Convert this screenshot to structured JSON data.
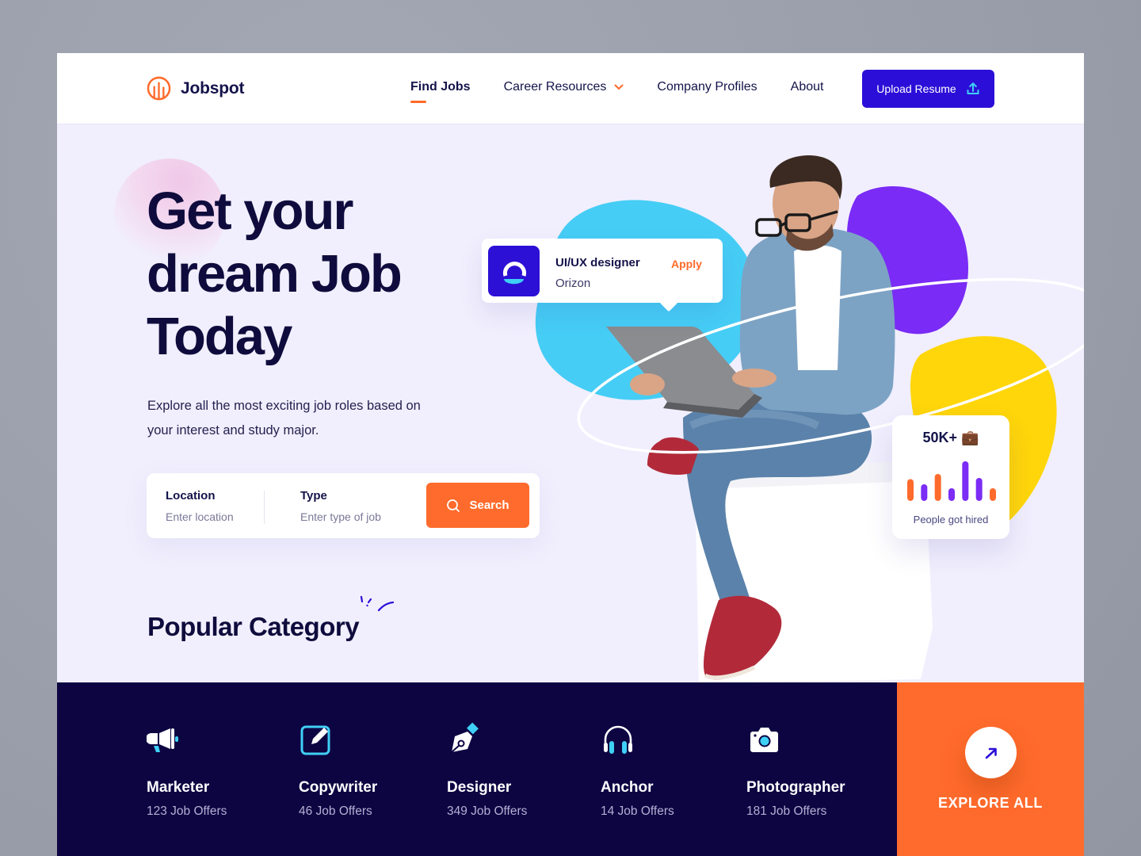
{
  "brand": {
    "name": "Jobspot",
    "accent": "#ff6b2c",
    "primary": "#2b0fd8",
    "dark": "#0d0442"
  },
  "nav": {
    "items": [
      {
        "label": "Find Jobs",
        "active": true
      },
      {
        "label": "Career Resources",
        "has_dropdown": true
      },
      {
        "label": "Company Profiles"
      },
      {
        "label": "About"
      }
    ],
    "cta_label": "Upload Resume",
    "cta_icon": "upload-icon"
  },
  "hero": {
    "title_lines": [
      "Get your",
      "dream Job",
      "Today"
    ],
    "subtitle": "Explore all the most exciting job roles based on your interest and study major."
  },
  "search": {
    "location": {
      "label": "Location",
      "placeholder": "Enter location",
      "value": ""
    },
    "type": {
      "label": "Type",
      "placeholder": "Enter type of job",
      "value": ""
    },
    "button_label": "Search",
    "button_icon": "search-icon"
  },
  "job_card": {
    "title": "UI/UX designer",
    "company": "Orizon",
    "action": "Apply",
    "logo_color": "#2c10d6"
  },
  "stat_card": {
    "value": "50K+",
    "emoji": "💼",
    "label": "People got hired",
    "bars": [
      {
        "value": 0.55,
        "color": "#ff6b2c"
      },
      {
        "value": 0.42,
        "color": "#7b2cf5"
      },
      {
        "value": 0.68,
        "color": "#ff6b2c"
      },
      {
        "value": 0.32,
        "color": "#7b2cf5"
      },
      {
        "value": 1.0,
        "color": "#7b2cf5"
      },
      {
        "value": 0.58,
        "color": "#7b2cf5"
      },
      {
        "value": 0.32,
        "color": "#ff6b2c"
      }
    ]
  },
  "popular": {
    "title": "Popular Category",
    "categories": [
      {
        "name": "Marketer",
        "count": "123 Job Offers",
        "icon": "megaphone-icon"
      },
      {
        "name": "Copywriter",
        "count": "46 Job Offers",
        "icon": "edit-icon"
      },
      {
        "name": "Designer",
        "count": "349 Job Offers",
        "icon": "pen-tool-icon"
      },
      {
        "name": "Anchor",
        "count": "14 Job Offers",
        "icon": "headphones-icon"
      },
      {
        "name": "Photographer",
        "count": "181 Job Offers",
        "icon": "camera-icon"
      }
    ],
    "explore_label": "EXPLORE ALL",
    "explore_icon": "arrow-up-right-icon"
  }
}
